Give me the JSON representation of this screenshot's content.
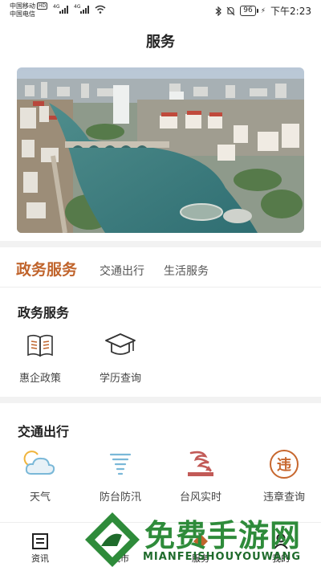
{
  "status_bar": {
    "carrier1": "中国移动",
    "hd": "HD",
    "carrier2": "中国电信",
    "net1": "4G",
    "net2": "4G",
    "battery": "96",
    "time": "下午2:23"
  },
  "header": {
    "title": "服务"
  },
  "tabs": [
    {
      "label": "政务服务",
      "active": true
    },
    {
      "label": "交通出行",
      "active": false
    },
    {
      "label": "生活服务",
      "active": false
    }
  ],
  "sections": {
    "gov": {
      "title": "政务服务",
      "items": [
        {
          "label": "惠企政策",
          "icon": "book-icon"
        },
        {
          "label": "学历查询",
          "icon": "graduation-cap-icon"
        }
      ]
    },
    "traffic": {
      "title": "交通出行",
      "items": [
        {
          "label": "天气",
          "icon": "weather-icon"
        },
        {
          "label": "防台防汛",
          "icon": "typhoon-icon"
        },
        {
          "label": "台风实时",
          "icon": "typhoon-live-icon"
        },
        {
          "label": "违章查询",
          "icon": "violation-icon",
          "glyph": "违"
        }
      ]
    }
  },
  "bottom_nav": [
    {
      "label": "资讯",
      "icon": "news-icon"
    },
    {
      "label": "城市",
      "icon": "city-icon"
    },
    {
      "label": "服务",
      "icon": "service-icon"
    },
    {
      "label": "我的",
      "icon": "profile-icon"
    }
  ],
  "watermark": {
    "cn": "免费手游网",
    "en": "MIANFEISHOUYOUWANG"
  },
  "colors": {
    "accent": "#c0642c",
    "weather_blue": "#7ab8d8",
    "typhoon_red": "#c25a57",
    "violation_orange": "#c7672e",
    "watermark_green": "#2e8b3a"
  }
}
